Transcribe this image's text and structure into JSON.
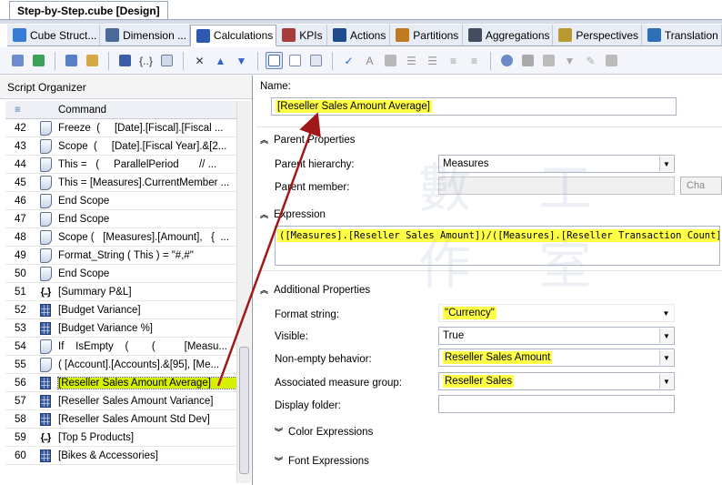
{
  "document_tab": "Step-by-Step.cube [Design]",
  "designer_tabs": [
    {
      "label": "Cube Struct...",
      "color": "#3a7bd5"
    },
    {
      "label": "Dimension ...",
      "color": "#4a6b9a"
    },
    {
      "label": "Calculations",
      "color": "#2d59b0"
    },
    {
      "label": "KPIs",
      "color": "#a83c3c"
    },
    {
      "label": "Actions",
      "color": "#1e4c8c"
    },
    {
      "label": "Partitions",
      "color": "#c07a20"
    },
    {
      "label": "Aggregations",
      "color": "#444c60"
    },
    {
      "label": "Perspectives",
      "color": "#b89a30"
    },
    {
      "label": "Translation",
      "color": "#2f6fb8"
    }
  ],
  "organizer": {
    "title": "Script Organizer",
    "column_header": "Command",
    "rows": [
      {
        "num": "42",
        "type": "script",
        "cmd": "Freeze  (     [Date].[Fiscal].[Fiscal ..."
      },
      {
        "num": "43",
        "type": "script",
        "cmd": "Scope  (     [Date].[Fiscal Year].&[2..."
      },
      {
        "num": "44",
        "type": "script",
        "cmd": "This =   (     ParallelPeriod       // ..."
      },
      {
        "num": "45",
        "type": "script",
        "cmd": "This = [Measures].CurrentMember ..."
      },
      {
        "num": "46",
        "type": "script",
        "cmd": "End Scope"
      },
      {
        "num": "47",
        "type": "script",
        "cmd": "End Scope"
      },
      {
        "num": "48",
        "type": "script",
        "cmd": "Scope (   [Measures].[Amount],   {  ..."
      },
      {
        "num": "49",
        "type": "script",
        "cmd": "Format_String ( This ) = \"#,#\""
      },
      {
        "num": "50",
        "type": "script",
        "cmd": "End Scope"
      },
      {
        "num": "51",
        "type": "set",
        "cmd": "[Summary P&L]"
      },
      {
        "num": "52",
        "type": "calc",
        "cmd": "[Budget Variance]"
      },
      {
        "num": "53",
        "type": "calc",
        "cmd": "[Budget Variance %]"
      },
      {
        "num": "54",
        "type": "script",
        "cmd": "If    IsEmpty    (        (          [Measu..."
      },
      {
        "num": "55",
        "type": "script",
        "cmd": "( [Account].[Accounts].&[95], [Me..."
      },
      {
        "num": "56",
        "type": "calc",
        "cmd": "[Reseller Sales Amount Average]",
        "selected": true
      },
      {
        "num": "57",
        "type": "calc",
        "cmd": "[Reseller Sales Amount Variance]"
      },
      {
        "num": "58",
        "type": "calc",
        "cmd": "[Reseller Sales Amount Std Dev]"
      },
      {
        "num": "59",
        "type": "set",
        "cmd": "[Top 5 Products]"
      },
      {
        "num": "60",
        "type": "calc",
        "cmd": "[Bikes & Accessories]"
      }
    ]
  },
  "form": {
    "name_label": "Name:",
    "name_value": "[Reseller Sales Amount Average]",
    "parent_properties": "Parent Properties",
    "parent_hierarchy_label": "Parent hierarchy:",
    "parent_hierarchy_value": "Measures",
    "parent_member_label": "Parent member:",
    "change_button": "Cha",
    "expression_label": "Expression",
    "expression_value": "([Measures].[Reseller Sales Amount])/([Measures].[Reseller Transaction Count])",
    "additional_properties": "Additional Properties",
    "format_string_label": "Format string:",
    "format_string_value": "\"Currency\"",
    "visible_label": "Visible:",
    "visible_value": "True",
    "non_empty_label": "Non-empty behavior:",
    "non_empty_value": "Reseller Sales Amount",
    "assoc_group_label": "Associated measure group:",
    "assoc_group_value": "Reseller Sales",
    "display_folder_label": "Display folder:",
    "display_folder_value": "",
    "color_expressions": "Color Expressions",
    "font_expressions": "Font Expressions"
  },
  "colors": {
    "highlight": "#ffff46",
    "selection": "#d6f000",
    "arrow": "#a01818"
  },
  "watermark": "數 工 作 室"
}
